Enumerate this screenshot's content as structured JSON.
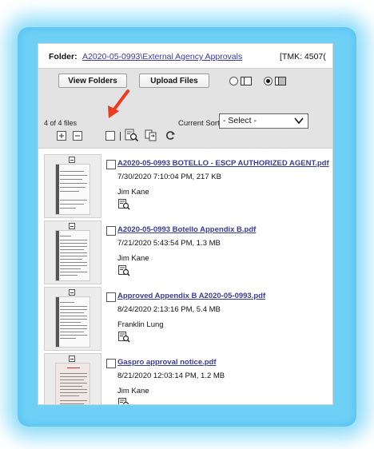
{
  "folder": {
    "label": "Folder:",
    "path": "A2020-05-0993\\External Agency Approvals",
    "tmk": "[TMK: 4507("
  },
  "toolbar": {
    "view_folders": "View Folders",
    "upload_files": "Upload Files",
    "view_mode_selected": "detail",
    "file_count": "4 of 4 files",
    "sort_label": "Current Sort:",
    "sort_value": "- Select -"
  },
  "icons": {
    "expand": "plus-box-icon",
    "collapse": "minus-box-icon",
    "preview": "magnify-document-icon",
    "copy": "copy-to-icon",
    "refresh": "refresh-icon",
    "annotation_color": "#ee3a1f"
  },
  "files": [
    {
      "name": "A2020-05-0993 BOTELLO - ESCP AUTHORIZED AGENT.pdf",
      "meta": "7/30/2020 7:10:04 PM, 217 KB",
      "author": "Jim Kane"
    },
    {
      "name": "A2020-05-0993 Botello Appendix B.pdf",
      "meta": "7/21/2020 5:43:54 PM, 1.3 MB",
      "author": "Jim Kane"
    },
    {
      "name": "Approved Appendix B A2020-05-0993.pdf",
      "meta": "8/24/2020 2:13:16 PM, 5.4 MB",
      "author": "Franklin Lung"
    },
    {
      "name": "Gaspro approval notice.pdf",
      "meta": "8/21/2020 12:03:14 PM, 1.2 MB",
      "author": "Jim Kane"
    }
  ]
}
